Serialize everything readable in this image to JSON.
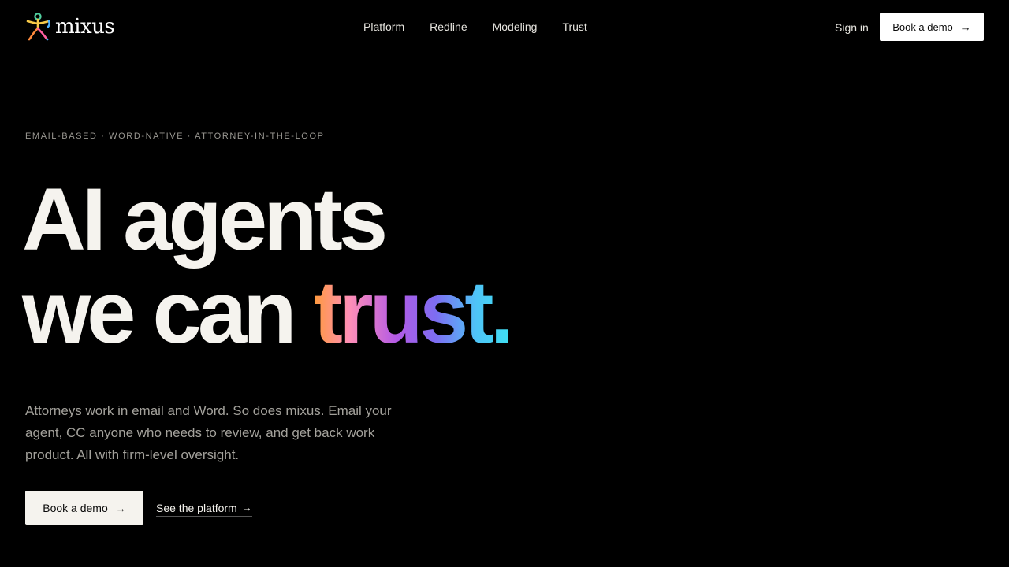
{
  "brand": {
    "name": "mixus",
    "logo_colors": [
      "#f7c948",
      "#52d0a0",
      "#4fb3ff",
      "#ff8a3c",
      "#ff5fa2"
    ]
  },
  "nav": {
    "links": [
      "Platform",
      "Redline",
      "Modeling",
      "Trust"
    ],
    "sign_in": "Sign in",
    "cta_label": "Book a demo",
    "cta_icon": "arrow-right-icon"
  },
  "hero": {
    "eyebrow": "EMAIL-BASED · WORD-NATIVE · ATTORNEY-IN-THE-LOOP",
    "headline_line1": "AI agents",
    "headline_line2_plain": "we can ",
    "headline_line2_gradient": "trust.",
    "gradient_colors": [
      "#ff9a3c",
      "#ff8fb7",
      "#b35ae6",
      "#7d6df2",
      "#4fc3f7",
      "#3ee0f2"
    ],
    "subcopy": "Attorneys work in email and Word. So does mixus. Email your agent, CC anyone who needs to review, and get back work product. All with firm-level oversight.",
    "primary_cta": "Book a demo",
    "secondary_cta": "See the platform",
    "arrow_glyph": "→"
  },
  "colors": {
    "background": "#000000",
    "text": "#f5f3ee",
    "muted": "#a3a19b"
  }
}
